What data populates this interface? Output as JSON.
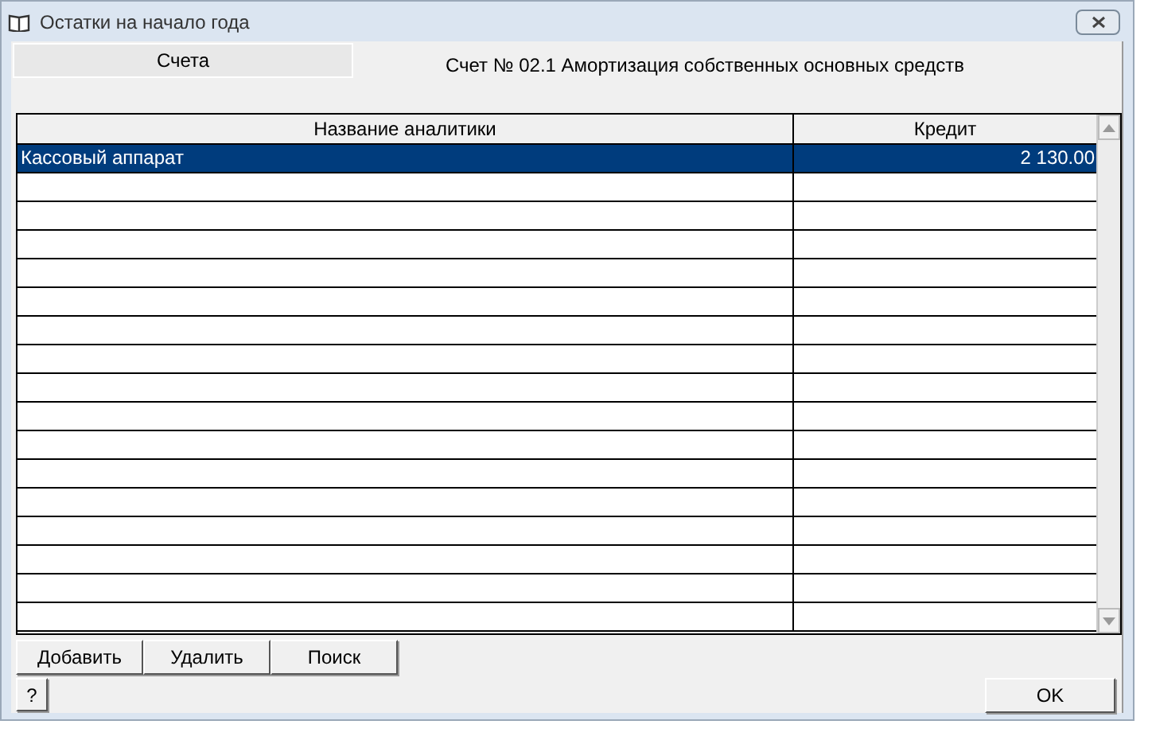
{
  "window": {
    "title": "Остатки на начало года"
  },
  "tabs": [
    {
      "label": "Счета",
      "selected": false
    }
  ],
  "account_label": "Счет № 02.1  Амортизация собственных основных средств",
  "table": {
    "columns": [
      "Название аналитики",
      "Кредит"
    ],
    "rows": [
      {
        "name": "Кассовый аппарат",
        "credit": "2 130.00",
        "selected": true
      }
    ]
  },
  "buttons": [
    "Добавить",
    "Удалить",
    "Поиск"
  ],
  "help_button": "?",
  "ok_button": "OK"
}
